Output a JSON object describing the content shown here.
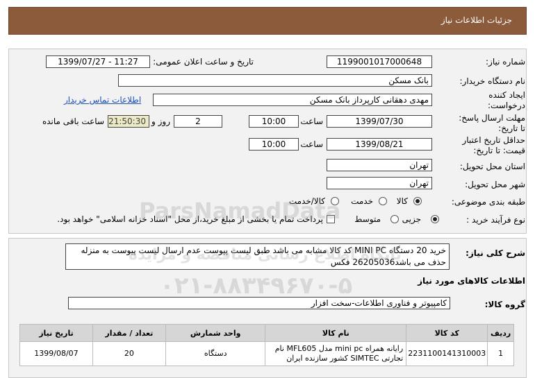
{
  "header": {
    "title": "جزئیات اطلاعات نیاز"
  },
  "form": {
    "need_number_label": "شماره نیاز:",
    "need_number": "1199001017000648",
    "announce_label": "تاریخ و ساعت اعلان عمومی:",
    "announce_value": "1399/07/27 - 11:27",
    "buyer_label": "نام دستگاه خریدار:",
    "buyer_value": "بانک مسکن",
    "creator_label_1": "ایجاد کننده",
    "creator_label_2": "درخواست:",
    "creator_value": "مهدی دهقانی کارپرداز بانک مسکن",
    "contact_link": "اطلاعات تماس خریدار",
    "deadline_label_1": "مهلت ارسال پاسخ:",
    "deadline_label_2": "تا تاریخ:",
    "deadline_date": "1399/07/30",
    "time_label": "ساعت",
    "deadline_time": "10:00",
    "days_value": "2",
    "days_label": "روز و",
    "remaining_time": "21:50:30",
    "remaining_label": "ساعت باقی مانده",
    "validity_label_1": "حداقل تاریخ اعتبار",
    "validity_label_2": "قیمت: تا تاریخ:",
    "validity_date": "1399/08/21",
    "validity_time_label": "ساعت",
    "validity_time": "10:00",
    "province_label": "استان محل تحویل:",
    "province_value": "تهران",
    "city_label": "شهر محل تحویل:",
    "city_value": "تهران",
    "category_label": "طبقه بندی موضوعی:",
    "category_options": [
      "کالا",
      "خدمت",
      "کالا/خدمت"
    ],
    "process_label": "نوع فرآیند خرید :",
    "process_options": [
      "جزیی",
      "متوسط"
    ],
    "payment_note": "پرداخت تمام یا بخشی از مبلغ خرید،از محل \"اسناد خزانه اسلامی\" خواهد بود."
  },
  "description": {
    "label": "شرح کلی نیاز:",
    "text": "خرید 20 دستگاه MINI PC کد کالا مشابه می باشد طبق لیست پیوست عدم ارسال لیست پیوست به منزله حذف می باشد26205036 فکس"
  },
  "goods_section": {
    "title": "اطلاعات کالاهای مورد نیاز",
    "group_label": "گروه کالا:",
    "group_value": "کامپیوتر و فناوری اطلاعات-سخت افزار"
  },
  "table": {
    "headers": [
      "ردیف",
      "کد کالا",
      "نام کالا",
      "واحد شمارش",
      "تعداد / مقدار",
      "تاریخ نیاز"
    ],
    "rows": [
      {
        "row": "1",
        "code": "2231100141310003",
        "name": "رایانه همراه mini pc مدل MFL605 نام تجارتی SIMTEC کشور سازنده ایران",
        "unit": "دستگاه",
        "qty": "20",
        "date": "1399/08/07"
      }
    ]
  },
  "watermark": {
    "brand": "ParsNamadData",
    "line1": "پایگاه اطلاع رسانی مناقصه و مزایده",
    "phone": "۰۲۱-۸۸۳۴۹۶۷۰-۵"
  },
  "colors": {
    "header": "#8b5b3c",
    "panel": "#f2f2f2",
    "highlight": "#ecebc6",
    "link": "#1a4fb8"
  }
}
